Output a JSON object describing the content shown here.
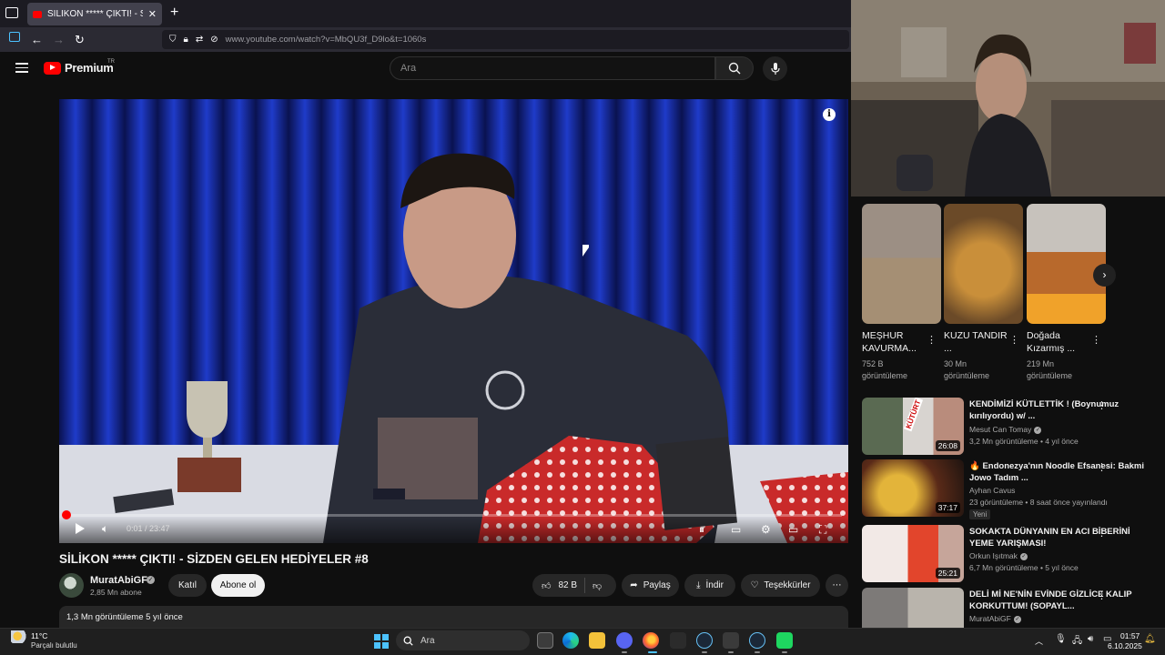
{
  "browser": {
    "tab_title": "SİLİKON ***** ÇIKTI! - SİZDEN GE",
    "url": "www.youtube.com/watch?v=MbQU3f_D9lo&t=1060s"
  },
  "yt_header": {
    "logo_text": "Premium",
    "country": "TR",
    "search_placeholder": "Ara"
  },
  "player": {
    "time": "0:01 / 23:47",
    "progress_fraction": 0.001,
    "info_icon": "i"
  },
  "video": {
    "title": "SİLİKON ***** ÇIKTI! - SİZDEN GELEN HEDİYELER #8",
    "channel": "MuratAbiGF",
    "subscribers": "2,85 Mn abone",
    "join_label": "Katıl",
    "subscribe_label": "Abone ol",
    "likes": "82 B",
    "share_label": "Paylaş",
    "download_label": "İndir",
    "thanks_label": "Teşekkürler",
    "description_meta": "1,3 Mn görüntüleme  5 yıl önce"
  },
  "shorts": [
    {
      "title": "MEŞHUR KAVURMA...",
      "views": "752 B görüntüleme"
    },
    {
      "title": "KUZU TANDIR ...",
      "views": "30 Mn görüntüleme"
    },
    {
      "title": "Doğada Kızarmış ...",
      "views": "219 Mn görüntüleme"
    }
  ],
  "recommendations": [
    {
      "title": "KENDİMİZİ KÜTLETTİK ! (Boynumuz kırılıyordu) w/ ...",
      "channel": "Mesut Can Tomay",
      "meta": "3,2 Mn görüntüleme • 4 yıl önce",
      "duration": "26:08",
      "thumb_label": "KÜTÜRT",
      "new_badge": ""
    },
    {
      "title": "🔥 Endonezya'nın Noodle Efsanesi: Bakmi Jowo Tadım ...",
      "channel": "Ayhan Cavus",
      "meta": "23 görüntüleme • 8 saat önce yayınlandı",
      "duration": "37:17",
      "thumb_label": "",
      "new_badge": "Yeni"
    },
    {
      "title": "SOKAKTA DÜNYANIN EN ACI BİBERİNİ YEME YARIŞMASI!",
      "channel": "Orkun Işıtmak",
      "meta": "6,7 Mn görüntüleme • 5 yıl önce",
      "duration": "25:21",
      "thumb_label": "",
      "new_badge": ""
    },
    {
      "title": "DELİ Mİ NE'NİN EVİNDE GİZLİCE KALIP KORKUTTUM! (SOPAYL...",
      "channel": "MuratAbiGF",
      "meta": "",
      "duration": "",
      "thumb_label": "",
      "new_badge": ""
    }
  ],
  "taskbar": {
    "temperature": "11°C",
    "weather": "Parçalı bulutlu",
    "search_label": "Ara",
    "time": "01:57",
    "date": "6.10.2025"
  },
  "colors": {
    "accent_red": "#ff0000",
    "background": "#0f0f0f",
    "surface": "#272727"
  }
}
